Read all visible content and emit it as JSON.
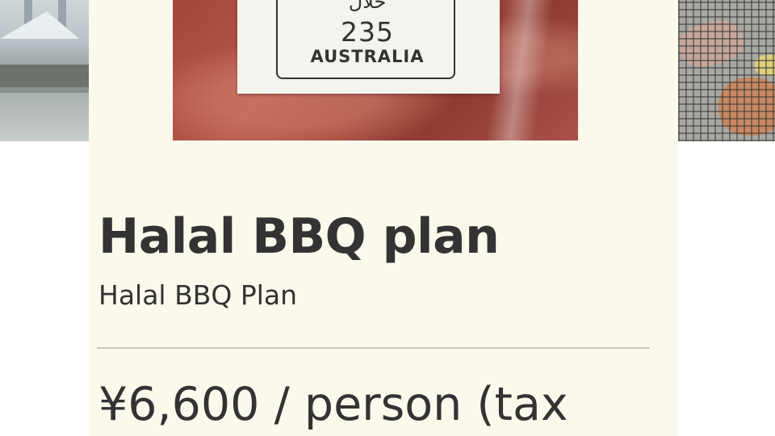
{
  "photo": {
    "stamp_script": "حلال",
    "stamp_number": "235",
    "stamp_country": "AUSTRALIA"
  },
  "plan": {
    "title": "Halal BBQ plan",
    "subtitle": "Halal BBQ Plan",
    "price": "¥6,600 / person (tax"
  }
}
